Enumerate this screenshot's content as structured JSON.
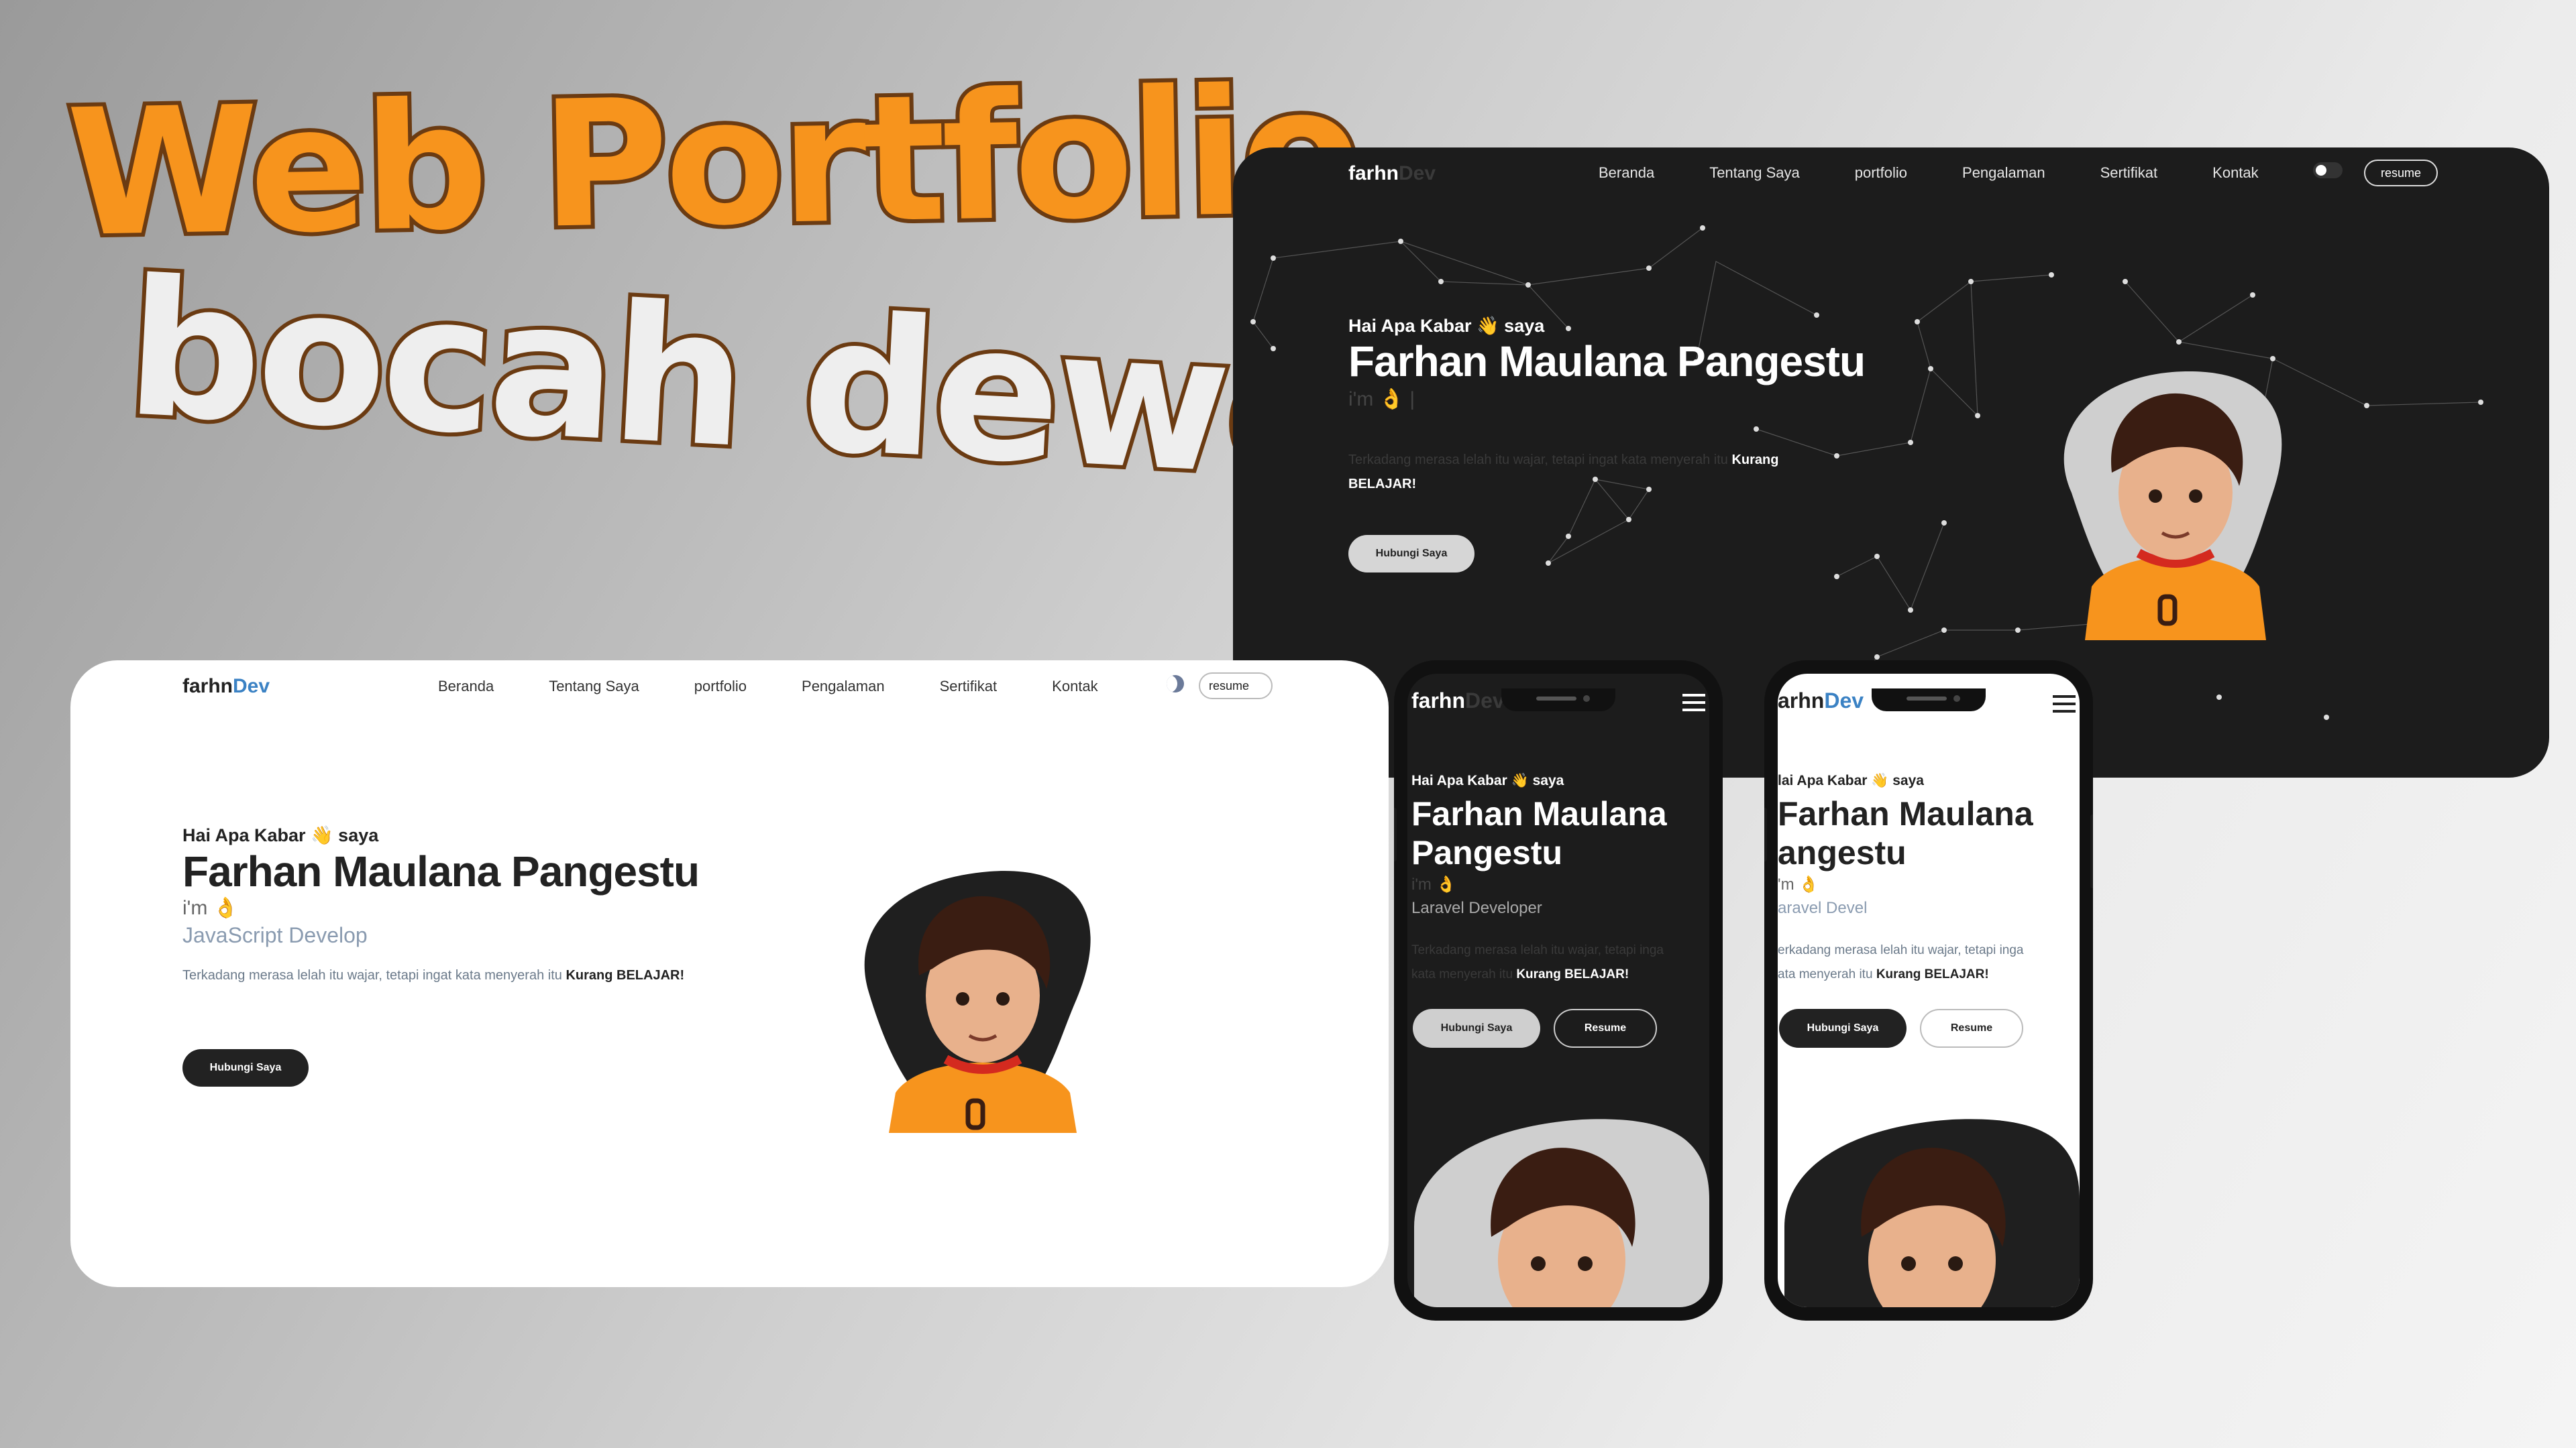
{
  "headline": {
    "line1": "Web Portfolio",
    "line2": "bocah dewe"
  },
  "site": {
    "logo_main": "farhn",
    "logo_accent": "Dev",
    "nav": [
      "Beranda",
      "Tentang Saya",
      "portfolio",
      "Pengalaman",
      "Sertifikat",
      "Kontak"
    ],
    "resume_label": "resume",
    "greeting": "Hai Apa Kabar 👋 saya",
    "name": "Farhan Maulana Pangestu",
    "im": "i'm 👌",
    "im_dark": "i'm 👌 |",
    "role_light": "JavaScript Develop",
    "role_phone_dark": "Laravel Developer",
    "role_phone_light": "aravel Devel",
    "quote_lead": "Terkadang merasa lelah itu wajar, tetapi ingat kata menyerah itu",
    "quote_strong_1": "Kurang",
    "quote_strong_2": "BELAJAR!",
    "phone_quote_l1": "Terkadang merasa lelah itu wajar, tetapi inga",
    "phone_quote_l2": "kata menyerah itu",
    "phone_quote_strong": "Kurang BELAJAR!",
    "contact_button": "Hubungi Saya",
    "resume_button": "Resume",
    "phone_logo_dark": "farhn",
    "phone_logo_accent_dark": "Dev",
    "phone_logo_light": "arhn",
    "phone_name_l1": "Farhan Maulana",
    "phone_name_l2": "Pangestu",
    "phone_greeting": "Hai Apa Kabar 👋 saya",
    "phone_light_greeting": "lai Apa Kabar 👋 saya",
    "phone_light_name_l1": "Farhan Maulana",
    "phone_light_name_l2": "angestu",
    "phone_light_im": "'m 👌",
    "phone_light_quote_l1": "erkadang merasa lelah itu wajar, tetapi inga",
    "phone_light_quote_l2": "ata menyerah itu"
  },
  "colors": {
    "accent_orange": "#f7941d",
    "brand_blue": "#3b82c4",
    "dark_bg": "#1c1c1c",
    "light_bg": "#ffffff"
  }
}
